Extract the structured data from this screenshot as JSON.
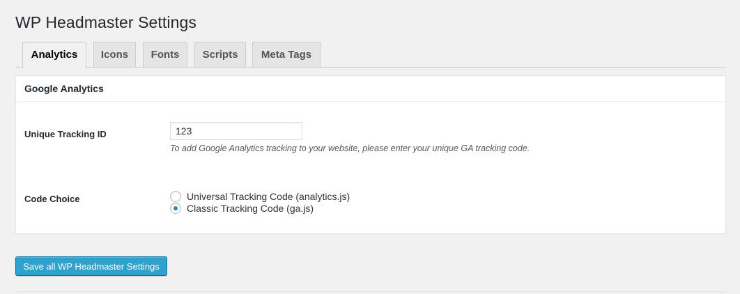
{
  "page": {
    "title": "WP Headmaster Settings"
  },
  "tabs": [
    {
      "label": "Analytics",
      "active": true
    },
    {
      "label": "Icons",
      "active": false
    },
    {
      "label": "Fonts",
      "active": false
    },
    {
      "label": "Scripts",
      "active": false
    },
    {
      "label": "Meta Tags",
      "active": false
    }
  ],
  "panel": {
    "title": "Google Analytics",
    "tracking_id": {
      "label": "Unique Tracking ID",
      "value": "123",
      "description": "To add Google Analytics tracking to your website, please enter your unique GA tracking code."
    },
    "code_choice": {
      "label": "Code Choice",
      "options": [
        {
          "label": "Universal Tracking Code (analytics.js)",
          "checked": false
        },
        {
          "label": "Classic Tracking Code (ga.js)",
          "checked": true
        }
      ]
    }
  },
  "save_button": {
    "label": "Save all WP Headmaster Settings"
  },
  "colors": {
    "accent": "#2ea2cc",
    "radio_dot": "#1e8cbe",
    "background": "#f1f1f1"
  }
}
